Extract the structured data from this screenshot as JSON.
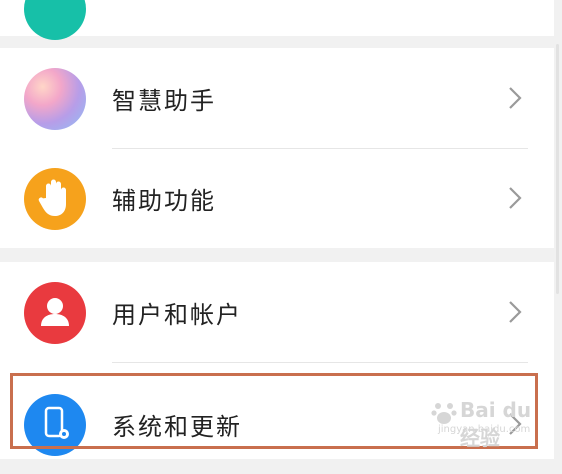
{
  "settings": {
    "items": [
      {
        "label": "智慧助手",
        "icon": "assistant-icon",
        "color": "#c9a6e8"
      },
      {
        "label": "辅助功能",
        "icon": "hand-icon",
        "color": "#f6a21c"
      },
      {
        "label": "用户和帐户",
        "icon": "user-icon",
        "color": "#e93a3f"
      },
      {
        "label": "系统和更新",
        "icon": "phone-settings-icon",
        "color": "#1e88f0"
      }
    ]
  },
  "highlight_color": "#c96f4e",
  "watermark": {
    "text": "Bai du 经验",
    "url": "jingyan.baidu.com"
  }
}
